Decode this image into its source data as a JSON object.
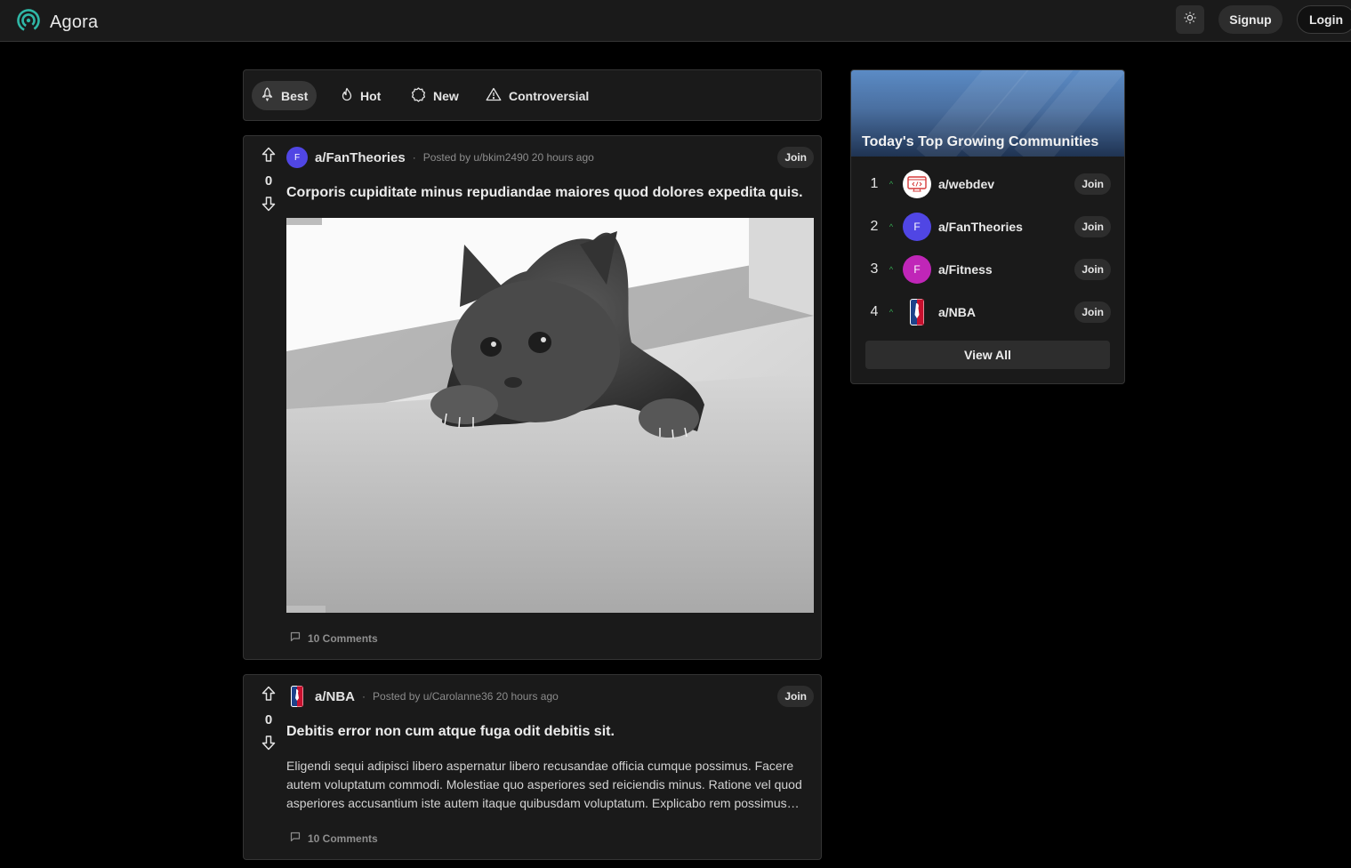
{
  "header": {
    "brand": "Agora",
    "theme_icon": "sun-icon",
    "signup_label": "Signup",
    "login_label": "Login"
  },
  "sort_tabs": [
    {
      "label": "Best",
      "icon": "rocket-icon",
      "active": true
    },
    {
      "label": "Hot",
      "icon": "flame-icon",
      "active": false
    },
    {
      "label": "New",
      "icon": "badge-icon",
      "active": false
    },
    {
      "label": "Controversial",
      "icon": "warning-icon",
      "active": false
    }
  ],
  "posts": [
    {
      "community": "a/FanTheories",
      "avatar_letter": "F",
      "avatar_color": "#5046e4",
      "posted_by": "Posted by u/bkim2490 20 hours ago",
      "score": "0",
      "title": "Corporis cupiditate minus repudiandae maiores quod dolores expedita quis.",
      "image": "grayscale photo of a gray kitten peeking over a burlap surface",
      "comments": "10 Comments",
      "join_label": "Join"
    },
    {
      "community": "a/NBA",
      "avatar_icon": "nba-logo-icon",
      "posted_by": "Posted by u/Carolanne36 20 hours ago",
      "score": "0",
      "title": "Debitis error non cum atque fuga odit debitis sit.",
      "body": "Eligendi sequi adipisci libero aspernatur libero recusandae officia cumque possimus. Facere autem voluptatum commodi. Molestiae quo asperiores sed reiciendis minus. Ratione vel quod asperiores accusantium iste autem itaque quibusdam voluptatum. Explicabo rem possimus…",
      "comments": "10 Comments",
      "join_label": "Join"
    }
  ],
  "sidebar": {
    "title": "Today's Top Growing Communities",
    "communities": [
      {
        "rank": "1",
        "name": "a/webdev",
        "avatar": "webdev-logo-icon",
        "join": "Join"
      },
      {
        "rank": "2",
        "name": "a/FanTheories",
        "avatar_letter": "F",
        "avatar_color": "#5046e4",
        "join": "Join"
      },
      {
        "rank": "3",
        "name": "a/Fitness",
        "avatar_letter": "F",
        "avatar_color": "#c026b8",
        "join": "Join"
      },
      {
        "rank": "4",
        "name": "a/NBA",
        "avatar": "nba-logo-icon",
        "join": "Join"
      }
    ],
    "view_all": "View All"
  },
  "colors": {
    "brand_accent": "#2fb7a6",
    "background": "#000000",
    "card": "#1a1a1a",
    "rank_up": "#36a852"
  }
}
